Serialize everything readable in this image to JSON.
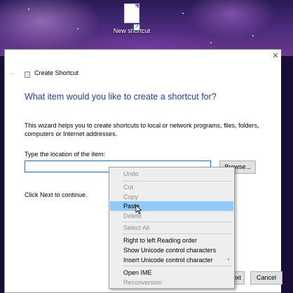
{
  "desktop": {
    "shortcut_label": "New shortcut"
  },
  "wizard": {
    "title": "Create Shortcut",
    "close_glyph": "✕",
    "back_glyph": "←",
    "heading": "What item would you like to create a shortcut for?",
    "description": "This wizard helps you to create shortcuts to local or network programs, files, folders, computers or Internet addresses.",
    "location_label": "Type the location of the item:",
    "location_value": "",
    "browse_label": "Browse...",
    "next_hint": "Click Next to continue.",
    "next_label": "Next",
    "cancel_label": "Cancel"
  },
  "context_menu": {
    "items": [
      {
        "label": "Undo",
        "enabled": false
      },
      {
        "label": "Cut",
        "enabled": false
      },
      {
        "label": "Copy",
        "enabled": false
      },
      {
        "label": "Paste",
        "enabled": true,
        "highlighted": true
      },
      {
        "label": "Delete",
        "enabled": false
      },
      {
        "label": "Select All",
        "enabled": false
      },
      {
        "label": "Right to left Reading order",
        "enabled": true
      },
      {
        "label": "Show Unicode control characters",
        "enabled": true
      },
      {
        "label": "Insert Unicode control character",
        "enabled": true,
        "submenu": true
      },
      {
        "label": "Open IME",
        "enabled": true
      },
      {
        "label": "Reconversion",
        "enabled": false
      }
    ],
    "submenu_glyph": "›"
  },
  "colors": {
    "heading": "#1b3ea3",
    "menu_highlight": "#91c9f7",
    "input_border": "#0078d7"
  }
}
